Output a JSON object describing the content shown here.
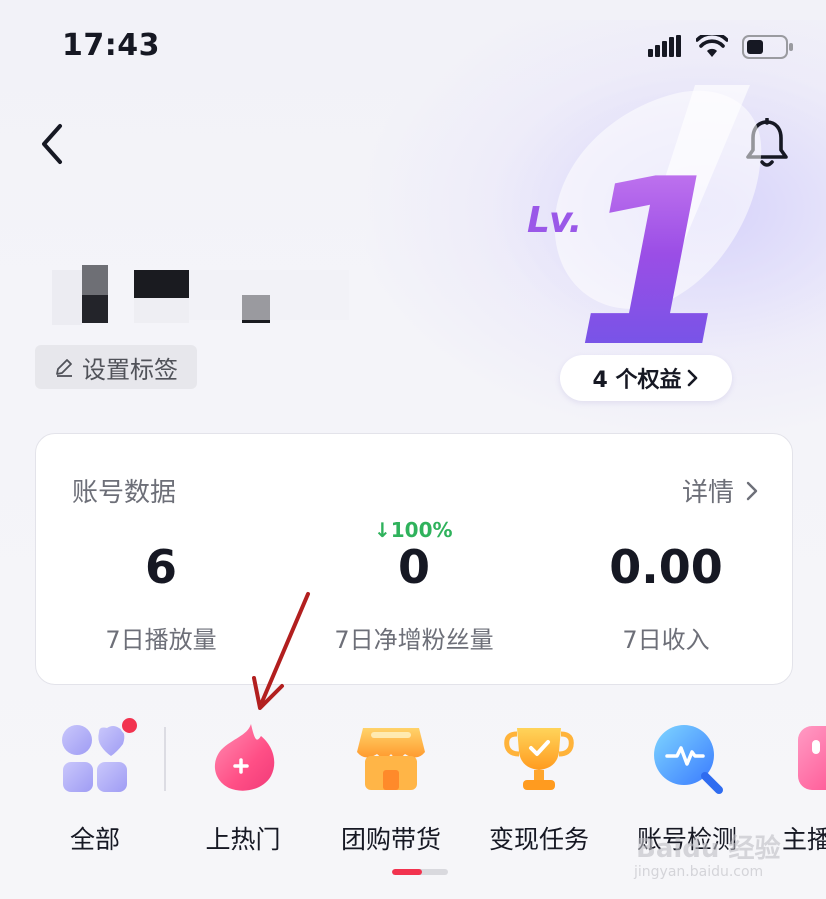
{
  "status_bar": {
    "time": "17:43"
  },
  "header": {
    "back_icon": "chevron-left-icon",
    "bell_icon": "bell-icon"
  },
  "level": {
    "prefix": "Lv.",
    "number": "1",
    "perks_label": "4 个权益"
  },
  "profile": {
    "tag_label": "设置标签"
  },
  "account_card": {
    "title": "账号数据",
    "detail_label": "详情",
    "stats": [
      {
        "value": "6",
        "label": "7日播放量"
      },
      {
        "value": "0",
        "label": "7日净增粉丝量",
        "change": "↓100%"
      },
      {
        "value": "0.00",
        "label": "7日收入"
      }
    ]
  },
  "tools": [
    {
      "label": "全部",
      "icon": "apps-grid-icon"
    },
    {
      "label": "上热门",
      "icon": "flame-plus-icon"
    },
    {
      "label": "团购带货",
      "icon": "shop-icon"
    },
    {
      "label": "变现任务",
      "icon": "trophy-icon"
    },
    {
      "label": "账号检测",
      "icon": "magnifier-pulse-icon"
    },
    {
      "label": "主播",
      "icon": "pink-app-icon"
    }
  ],
  "watermark": {
    "text": "Baidu 经验",
    "url": "jingyan.baidu.com"
  },
  "colors": {
    "accent": "#f2334f",
    "positive": "#2fb25c",
    "level": "#9a4fe4"
  }
}
